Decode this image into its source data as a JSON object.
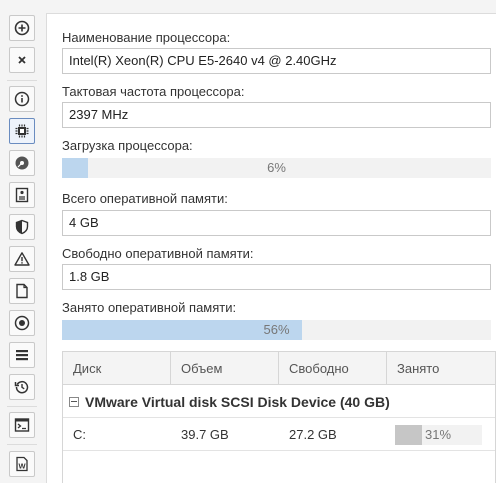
{
  "sidebar": {
    "items": [
      {
        "icon": "plus-circle-icon"
      },
      {
        "icon": "close-icon"
      },
      {
        "icon": "info-icon"
      },
      {
        "icon": "cpu-chip-icon",
        "active": true
      },
      {
        "icon": "disk-icon"
      },
      {
        "icon": "document-list-icon"
      },
      {
        "icon": "shield-icon"
      },
      {
        "icon": "warning-icon"
      },
      {
        "icon": "file-icon"
      },
      {
        "icon": "record-icon"
      },
      {
        "icon": "list-icon"
      },
      {
        "icon": "history-icon"
      },
      {
        "icon": "terminal-icon"
      },
      {
        "icon": "word-document-icon"
      }
    ]
  },
  "cpu": {
    "name_label": "Наименование процессора:",
    "name_value": "Intel(R) Xeon(R) CPU E5-2640 v4 @ 2.40GHz",
    "freq_label": "Тактовая частота процессора:",
    "freq_value": "2397 MHz",
    "load_label": "Загрузка процессора:",
    "load_percent": 6,
    "load_text": "6%"
  },
  "memory": {
    "total_label": "Всего оперативной памяти:",
    "total_value": "4 GB",
    "free_label": "Свободно оперативной памяти:",
    "free_value": "1.8 GB",
    "used_label": "Занято оперативной памяти:",
    "used_percent": 56,
    "used_text": "56%"
  },
  "disks": {
    "columns": [
      "Диск",
      "Объем",
      "Свободно",
      "Занято"
    ],
    "groups": [
      {
        "title": "VMware Virtual disk SCSI Disk Device (40 GB)",
        "rows": [
          {
            "disk": "C:",
            "size": "39.7 GB",
            "free": "27.2 GB",
            "used_percent": 31,
            "used_text": "31%"
          }
        ]
      }
    ]
  },
  "colors": {
    "bar_fill": "#bcd6ee",
    "mini_bar_fill": "#c6c6c6",
    "active_border": "#6a8cc0"
  }
}
